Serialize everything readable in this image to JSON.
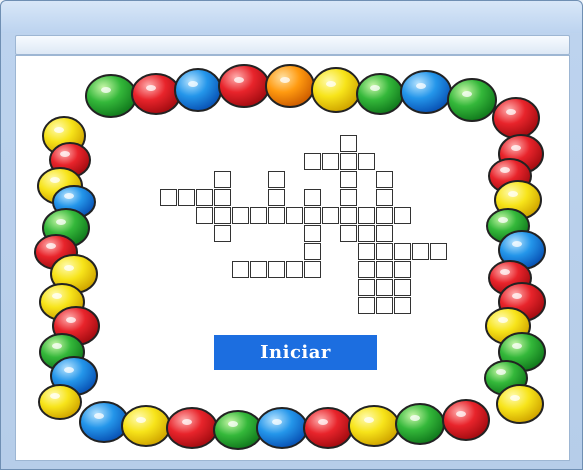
{
  "window": {
    "title": ""
  },
  "toolbar": {
    "items": []
  },
  "puzzle": {
    "start_button_label": "Iniciar",
    "credit_text": ""
  },
  "colors": {
    "window_frame": "#bcd3ef",
    "button": "#1c6ee0",
    "letter_palette": [
      "#f5e21b",
      "#1e90e8",
      "#e8242b",
      "#2fb43a",
      "#ff8a00"
    ]
  },
  "icons": {
    "border_art": "alphabet-letters-frame"
  }
}
